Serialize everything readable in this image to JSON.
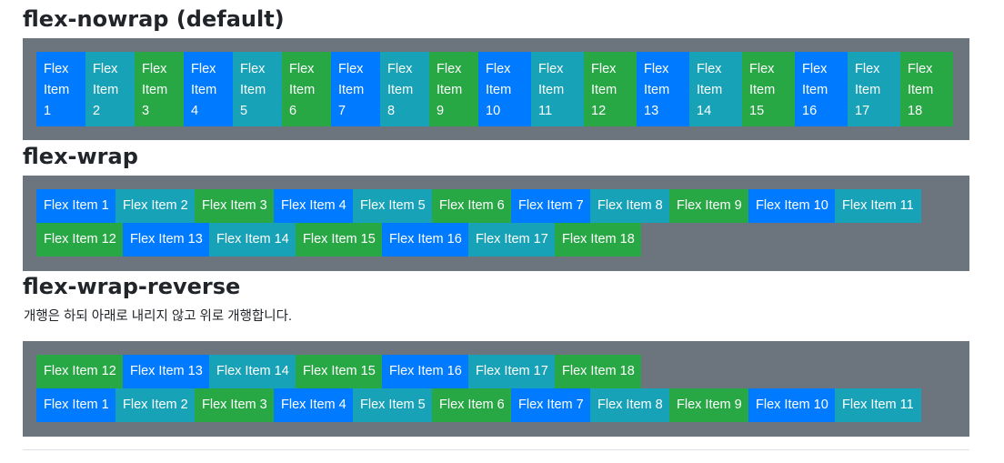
{
  "sections": {
    "nowrap": {
      "title": "flex-nowrap (default)"
    },
    "wrap": {
      "title": "flex-wrap"
    },
    "wrap_reverse": {
      "title": "flex-wrap-reverse",
      "description": "개행은 하되 아래로 내리지 않고 위로 개행합니다."
    }
  },
  "items": [
    "Flex Item 1",
    "Flex Item 2",
    "Flex Item 3",
    "Flex Item 4",
    "Flex Item 5",
    "Flex Item 6",
    "Flex Item 7",
    "Flex Item 8",
    "Flex Item 9",
    "Flex Item 10",
    "Flex Item 11",
    "Flex Item 12",
    "Flex Item 13",
    "Flex Item 14",
    "Flex Item 15",
    "Flex Item 16",
    "Flex Item 17",
    "Flex Item 18"
  ],
  "item_color_cycle": [
    "#007bff",
    "#17a2b8",
    "#28a745"
  ],
  "container_bg": "#6c757d"
}
